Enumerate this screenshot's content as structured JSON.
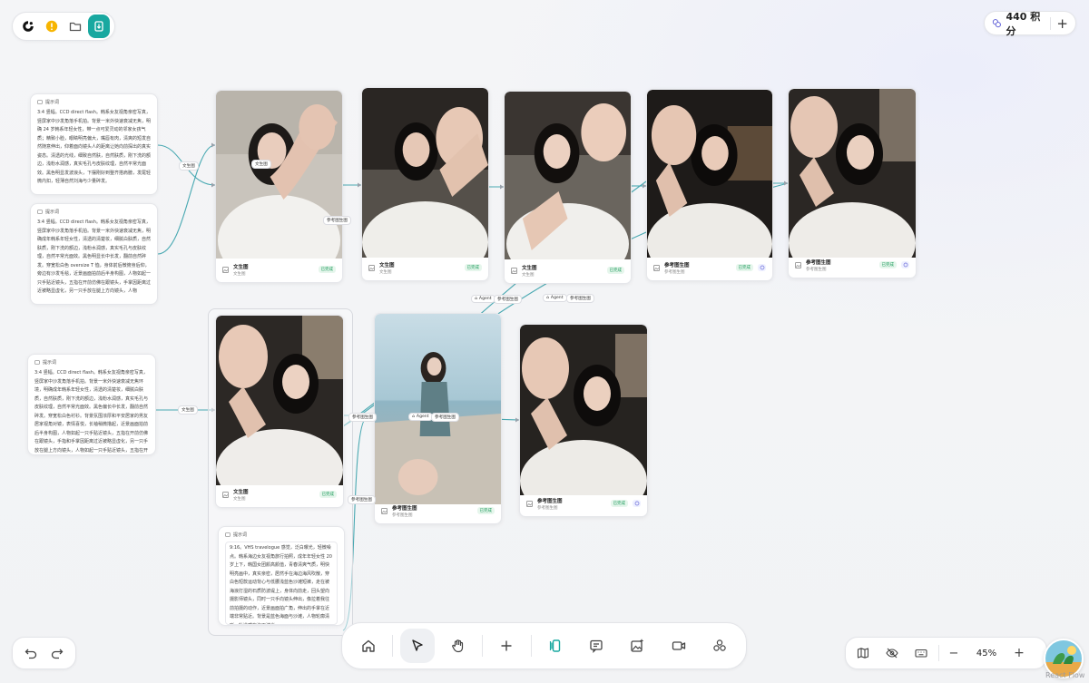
{
  "topbar": {
    "logo": "logo-icon",
    "icons": [
      "alert-circle-icon",
      "folder-icon",
      "export-icon"
    ]
  },
  "credits": {
    "text": "440 积分",
    "add_label": "+"
  },
  "prompts": [
    {
      "header": "提示词",
      "text": "3:4 竖幅。CCD direct flash。韩系女友视角亲密写真，竖屏家中沙发角落手机拍。背景一米外快速衰减无焦，明确 24 岁韩系年轻女性，带一点可爱灵动的邻家女孩气质；精致小脸，眼睛明亮偏大，嘴唇有肉，清爽的短发自然随意伸出，仰着面向镜头人的距离让她向前探出的真实姿态。清透的光线，细致自然肤，自然肤质，刚下洗的额边，浅粉水润感，真实毛孔与皮肤纹理，自然平常光面效。黑色明显发波浪头，下摆刚好到整齐搭肩膀，发尾轻微内扣，轻薄自然刘海与少量碎发。"
    },
    {
      "header": "提示词",
      "text": "3:4 竖幅。CCD direct flash。韩系女友视角亲密写真，竖屏家中沙发角落手机拍。背景一米外快速衰减无焦，明确成年韩系年轻女性，清透的清楚妆，细腻白肤质，自然肤质，刚下洗的额边，浅粉水润感，真实毛孔与皮肤纹理，自然平常光面效。黑色明显长中长发，翻前自然碎发。穿宽松白色 oversize T 恤，身体前后微俯身后仰，旁边有沙发毛毯，近景画面拍前后半身构图，人物如起一只手贴近镜头，五指在开前仿佛在跟镜头，手掌因距离过近被略显虚化，另一只手放在腿上方向镜头，人物"
    },
    {
      "header": "提示词",
      "text": "3:4 竖幅。CCD direct flash。韩系女友视角亲密写真，竖屏家中沙发角落手机拍。背景一米外快速衰减无焦环境，明确成年韩系年轻女性，清透的清楚妆，细腻白肤质，自然肤质，刚下洗的额边，浅粉水润感，真实毛孔与皮肤纹理，自然平常光面效。黑色偏长中长发，翻前自然碎发。穿宽松白色衬衫。背景氛围浓厚和平安居家的男友居家视角对镜，表情喜悦，长袖稍微撸起，近景画面拍前后半身构图，人物如起一只手贴近镜头，五指在开前仿佛在跟镜头，手指和手掌因距离过近被略显虚化，另一只手放在腿上方向镜头，人物如起一只手贴近镜头，五指在开前仿佛"
    },
    {
      "header": "提示词",
      "text": "9:16。VHS travelogue 感觉，泛白曝光，轻微噪点。韩系海边女友视角旅行拍照，成年年轻女性 20 岁上下，韩国女团颜高颜值，青春清爽气质，明快明亮画中，真实亲密，居然手在海边海风吹散，穿白色短款运动背心与低腰浅蓝色沙滩短裤，走在被海浪打湿的石质防波堤上，身体向前走，回头望向摄影师镜头，同时一只手向镜头伸出，像拉着我往前拍摄的动作，近景画面拍广角，伸出的手掌在近端非常贴近。背景是蓝色海面与沙滩，人物轮廓清晰，轨道感在海面波光"
    }
  ],
  "cards": [
    {
      "title": "文生图",
      "subtitle": "文生图",
      "badge": "已完成"
    },
    {
      "title": "文生图",
      "subtitle": "文生图",
      "badge": "已完成"
    },
    {
      "title": "文生图",
      "subtitle": "文生图",
      "badge": "已完成"
    },
    {
      "title": "参考图生图",
      "subtitle": "参考图生图",
      "badge": "已完成"
    },
    {
      "title": "参考图生图",
      "subtitle": "参考图生图",
      "badge": "已完成"
    },
    {
      "title": "文生图",
      "subtitle": "文生图",
      "badge": "已完成"
    },
    {
      "title": "参考图生图",
      "subtitle": "参考图生图",
      "badge": "已完成"
    },
    {
      "title": "参考图生图",
      "subtitle": "参考图生图",
      "badge": "已完成"
    }
  ],
  "edge_labels": {
    "t2i_a": "文生图",
    "t2i_b": "文生图",
    "t2i_c": "文生图",
    "agent_1": "Agent",
    "ref_1": "参考图生图",
    "agent_2": "Agent",
    "ref_2": "参考图生图",
    "agent_3": "Agent",
    "ref_3": "参考图生图",
    "ref_4": "参考图生图",
    "ref_5": "参考图生图"
  },
  "toolbar": {
    "tools": [
      "home-icon",
      "select-cursor-icon",
      "hand-pan-icon",
      "add-icon",
      "text-to-image-icon",
      "comment-icon",
      "image-generate-icon",
      "video-icon",
      "plugins-icon"
    ],
    "active": "select-cursor-icon"
  },
  "history": {
    "undo": "undo-icon",
    "redo": "redo-icon"
  },
  "view": {
    "map": "map-icon",
    "hide": "eye-off-icon",
    "keyboard": "keyboard-icon",
    "zoom_out": "−",
    "zoom": "45%",
    "zoom_in": "+"
  },
  "attribution": "React Flow",
  "colors": {
    "accent": "#18a8a0",
    "edge": "#4aa9b2",
    "success": "#1a9a5a"
  }
}
